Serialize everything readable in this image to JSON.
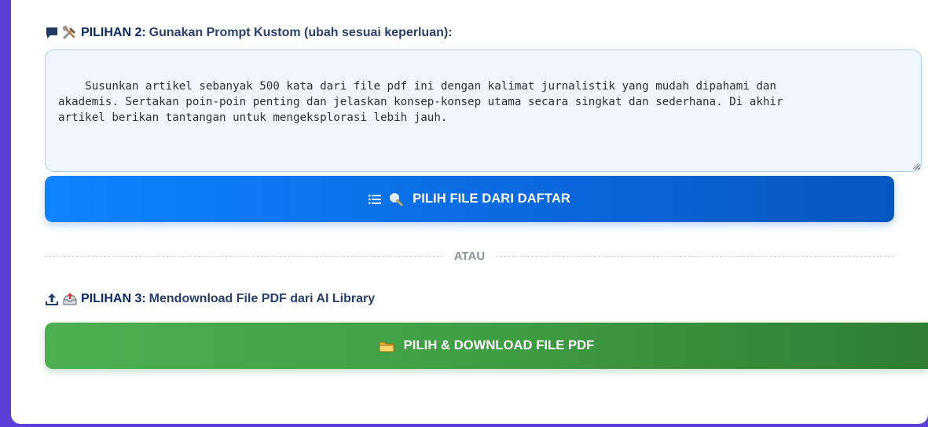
{
  "option2": {
    "label_strong": "PILIHAN 2:",
    "label_rest": "Gunakan Prompt Kustom (ubah sesuai keperluan):",
    "icons": [
      "speech-bubble-icon",
      "tools-icon"
    ]
  },
  "prompt": {
    "value": "Susunkan artikel sebanyak 500 kata dari file pdf ini dengan kalimat jurnalistik yang mudah dipahami dan\nakademis. Sertakan poin-poin penting dan jelaskan konsep-konsep utama secara singkat dan sederhana. Di akhir\nartikel berikan tantangan untuk mengeksplorasi lebih jauh."
  },
  "pick_file_button": {
    "label": "PILIH FILE DARI DAFTAR",
    "icons": [
      "list-icon",
      "magnifier-icon"
    ]
  },
  "divider": {
    "label": "ATAU"
  },
  "option3": {
    "label_strong": "PILIHAN 3:",
    "label_rest": "Mendownload File PDF dari AI Library",
    "icons": [
      "upload-arrow-icon",
      "inbox-upload-icon"
    ]
  },
  "download_button": {
    "label": "PILIH & DOWNLOAD FILE PDF",
    "icons": [
      "folder-icon"
    ]
  },
  "colors": {
    "accent_blue": "#0a6ae0",
    "accent_green": "#3f9e43",
    "heading_blue": "#1e3a8a",
    "frame_purple": "#5b3fd6"
  }
}
